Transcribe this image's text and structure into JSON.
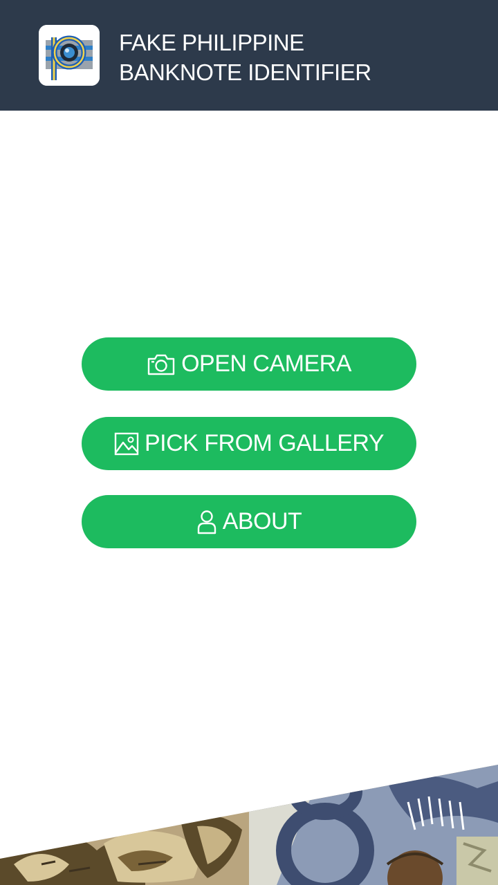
{
  "header": {
    "title_line1": "FAKE PHILIPPINE",
    "title_line2": "BANKNOTE IDENTIFIER",
    "background": "#2d3a4b",
    "logo_icon": "peso-camera-icon"
  },
  "actions": {
    "open_camera": {
      "label": "OPEN CAMERA",
      "icon": "camera-icon"
    },
    "pick_gallery": {
      "label": "PICK FROM GALLERY",
      "icon": "image-icon"
    },
    "about": {
      "label": "ABOUT",
      "icon": "user-icon"
    }
  },
  "colors": {
    "button": "#1dbb5f",
    "button_text": "#ffffff"
  },
  "footer": {
    "decoration": "banknote-collage-banner"
  }
}
